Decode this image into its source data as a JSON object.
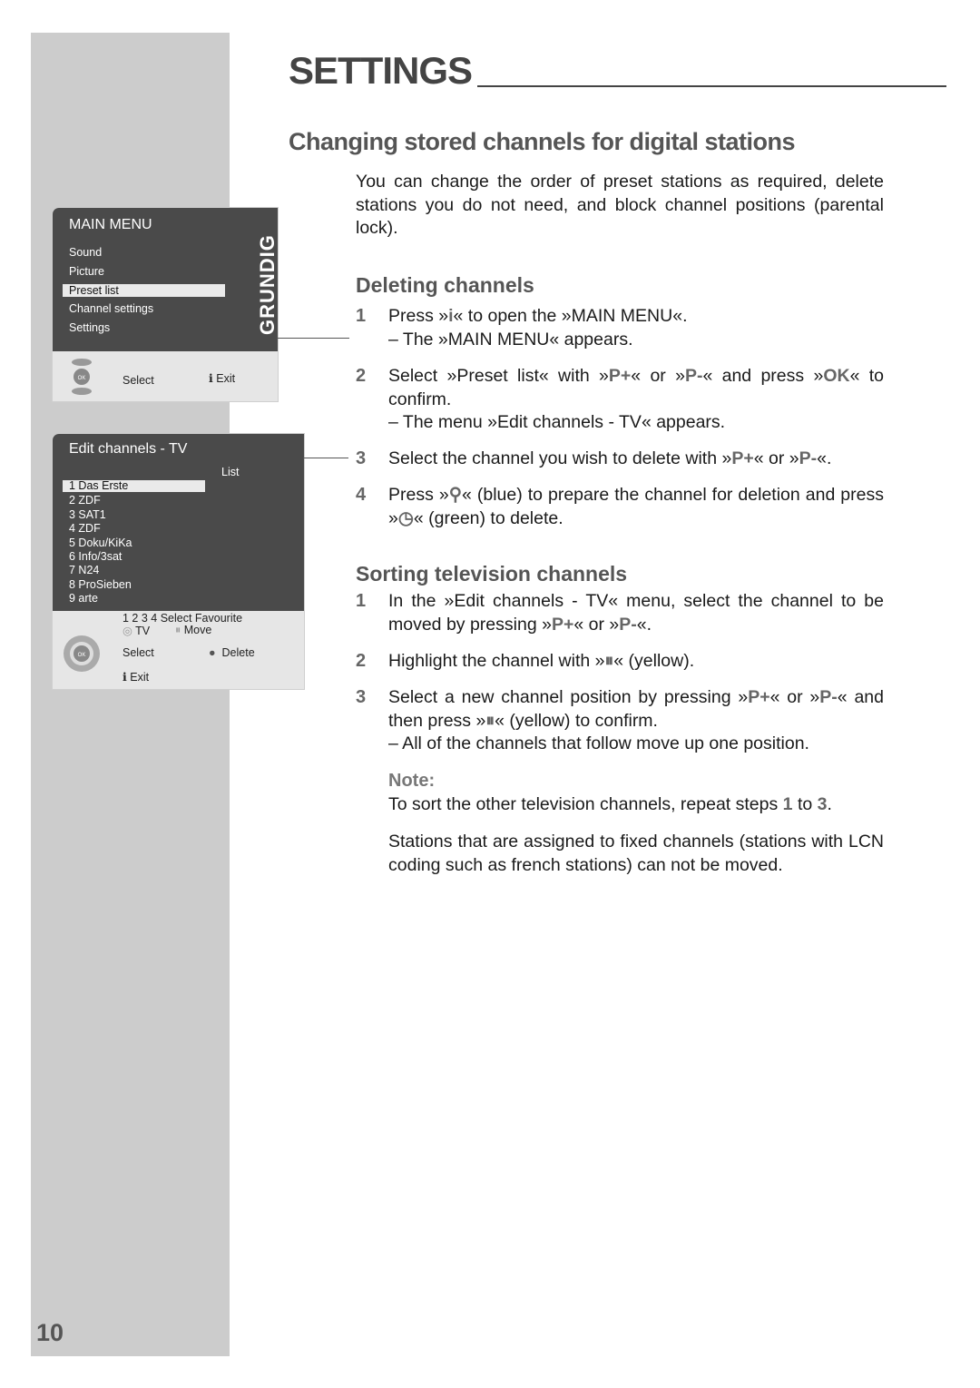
{
  "page": {
    "section_title": "SETTINGS",
    "heading": "Changing stored channels for digital stations",
    "intro": "You can change the order of preset stations as required, delete stations you do not need, and block channel positions (parental lock).",
    "page_number": "10"
  },
  "deleting": {
    "heading": "Deleting channels",
    "steps": [
      {
        "num": "1",
        "parts": [
          "Press »",
          "i",
          "« to open the »MAIN MENU«."
        ],
        "result": "– The »MAIN MENU« appears."
      },
      {
        "num": "2",
        "parts": [
          "Select »Preset list« with »",
          "P+",
          "« or »",
          "P-",
          "« and press »",
          "OK",
          "« to confirm."
        ],
        "result": "– The menu »Edit channels - TV« appears."
      },
      {
        "num": "3",
        "parts": [
          "Select the channel you wish to delete with »",
          "P+",
          "« or »",
          "P-",
          "«."
        ]
      },
      {
        "num": "4",
        "parts": [
          "Press »",
          "⚲",
          "« (blue) to prepare the channel for deletion and press »",
          "◷",
          "« (green) to delete."
        ]
      }
    ]
  },
  "sorting": {
    "heading": "Sorting television channels",
    "steps": [
      {
        "num": "1",
        "parts": [
          "In the »Edit channels - TV« menu, select the channel to be moved by pressing »",
          "P+",
          "« or »",
          "P-",
          "«."
        ]
      },
      {
        "num": "2",
        "parts": [
          "Highlight the channel with »",
          "⏸",
          "« (yellow)."
        ]
      },
      {
        "num": "3",
        "parts": [
          "Select a new channel position by pressing »",
          "P+",
          "« or »",
          "P-",
          "« and then press »",
          "⏸",
          "« (yellow) to confirm."
        ],
        "result": "– All of the channels that follow move up one position."
      }
    ],
    "note_label": "Note:",
    "note_parts": [
      "To sort the other television channels, repeat steps ",
      "1",
      " to ",
      "3",
      "."
    ],
    "note2": "Stations that are assigned to fixed channels (stations with LCN coding such as french stations) can not be moved."
  },
  "main_menu": {
    "title": "MAIN MENU",
    "brand": "GRUNDIG",
    "items": [
      "Sound",
      "Picture",
      "Preset list",
      "Channel settings",
      "Settings"
    ],
    "selected_index": 2,
    "footer": {
      "select": "Select",
      "exit": "Exit"
    }
  },
  "edit_channels": {
    "title": "Edit channels - TV",
    "list_label": "List",
    "channels": [
      "1 Das Erste",
      "2 ZDF",
      "3 SAT1",
      "4 ZDF",
      "5 Doku/KiKa",
      "6 Info/3sat",
      "7 N24",
      "8 ProSieben",
      "9 arte"
    ],
    "selected_index": 0,
    "footer": {
      "favourite": "1 2 3 4 Select Favourite",
      "tv": "TV",
      "move": "Move",
      "select": "Select",
      "delete": "Delete",
      "exit": "Exit"
    }
  }
}
